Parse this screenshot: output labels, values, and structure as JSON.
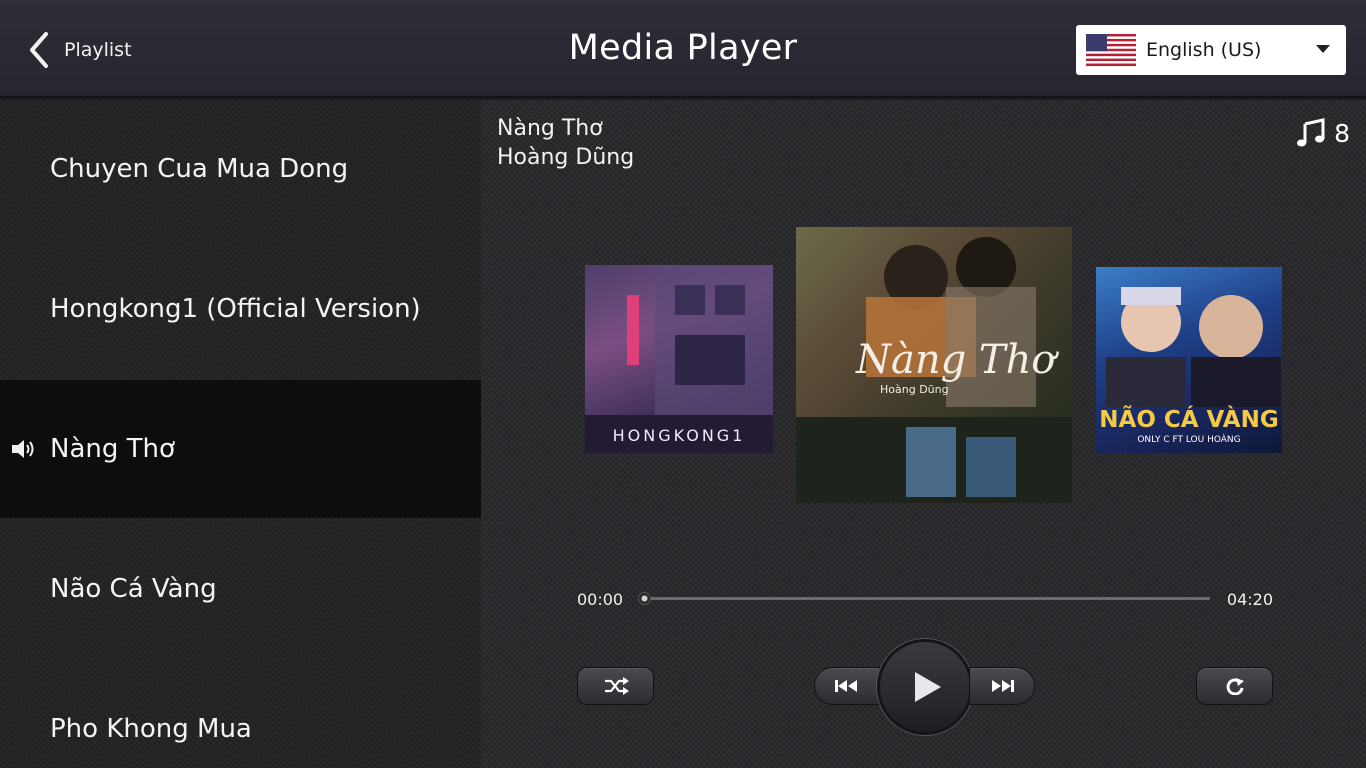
{
  "header": {
    "back_label": "Playlist",
    "title": "Media Player",
    "language": "English (US)",
    "language_flag": "us-flag-icon"
  },
  "playlist": [
    {
      "name": "Chuyen Cua Mua Dong",
      "playing": false
    },
    {
      "name": "Hongkong1 (Official Version)",
      "playing": false
    },
    {
      "name": "Nàng Thơ",
      "playing": true
    },
    {
      "name": "Não Cá Vàng",
      "playing": false
    },
    {
      "name": "Pho Khong Mua",
      "playing": false
    }
  ],
  "now_playing": {
    "title": "Nàng Thơ",
    "artist": "Hoàng Dũng",
    "track_count": "8",
    "time_current": "00:00",
    "time_total": "04:20",
    "progress_fraction": 0.0
  },
  "covers": {
    "left_text": "HONGKONG1",
    "center_text": "Nàng Thơ",
    "center_sub": "Hoàng Dũng",
    "right_text": "NÃO CÁ VÀNG",
    "right_sub": "ONLY C FT LOU HOÀNG"
  },
  "colors": {
    "accent_gold": "#f4c944",
    "active_row": "#0d0d0e"
  }
}
